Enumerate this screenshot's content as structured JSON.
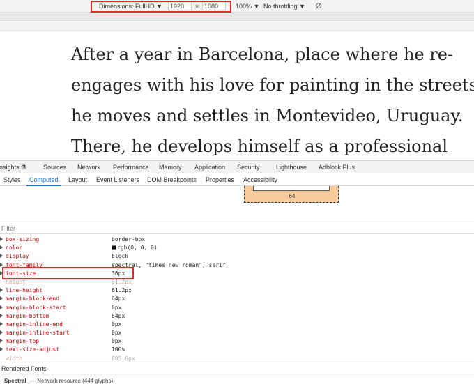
{
  "device_toolbar": {
    "dimensions_label": "Dimensions: FullHD ▼",
    "width_value": "1920",
    "times": "×",
    "height_value": "1080",
    "zoom": "100% ▼",
    "throttling": "No throttling ▼",
    "rotate_icon": "⊘"
  },
  "page": {
    "paragraph_lines": [
      "After a year in Barcelona, place where he re-",
      "engages with his love for painting in the streets,",
      "he moves and settles in Montevideo, Uruguay.",
      "There, he develops himself as a professional"
    ]
  },
  "devtools": {
    "tabs": [
      "nsights ⚗",
      "Sources",
      "Network",
      "Performance",
      "Memory",
      "Application",
      "Security",
      "Lighthouse",
      "Adblock Plus"
    ],
    "sub_tabs": [
      "Styles",
      "Computed",
      "Layout",
      "Event Listeners",
      "DOM Breakpoints",
      "Properties",
      "Accessibility"
    ],
    "active_sub_tab": "Computed",
    "box_model_value": "64",
    "filter_placeholder": "Filter",
    "properties": [
      {
        "name": "box-sizing",
        "value": "border-box"
      },
      {
        "name": "color",
        "value": "rgb(0, 0, 0)"
      },
      {
        "name": "display",
        "value": "block"
      },
      {
        "name": "font-family",
        "value": "spectral, \"times new roman\", serif"
      },
      {
        "name": "font-size",
        "value": "36px"
      },
      {
        "name": "height",
        "value": "61.2px"
      },
      {
        "name": "line-height",
        "value": "61.2px"
      },
      {
        "name": "margin-block-end",
        "value": "64px"
      },
      {
        "name": "margin-block-start",
        "value": "0px"
      },
      {
        "name": "margin-bottom",
        "value": "64px"
      },
      {
        "name": "margin-inline-end",
        "value": "0px"
      },
      {
        "name": "margin-inline-start",
        "value": "0px"
      },
      {
        "name": "margin-top",
        "value": "0px"
      },
      {
        "name": "text-size-adjust",
        "value": "100%"
      },
      {
        "name": "width",
        "value": "805.6px"
      }
    ],
    "rendered_fonts_label": "Rendered Fonts",
    "font_name": "Spectral",
    "font_source": "— Network resource (444 glyphs)"
  },
  "colors": {
    "highlight_border": "#d93025",
    "active_tab": "#1a73e8",
    "property_name": "#c80000",
    "box_model_fill": "#f9cc9d"
  }
}
